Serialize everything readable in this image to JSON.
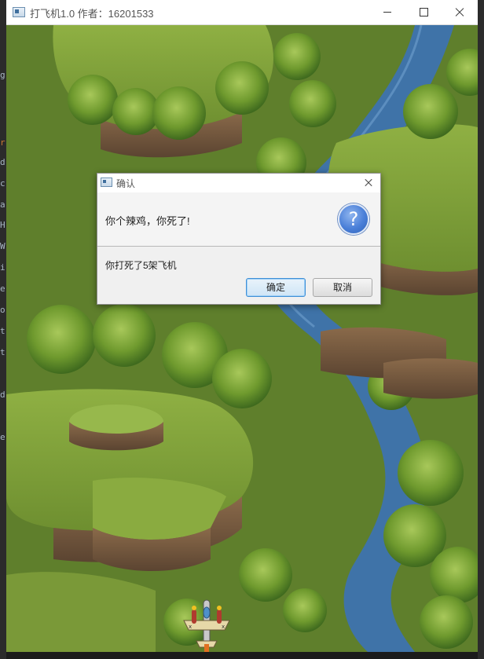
{
  "window": {
    "title": "打飞机1.0 作者：16201533",
    "controls": [
      "minimize",
      "maximize",
      "close"
    ]
  },
  "ide_edge_glyphs": [
    "g",
    "r",
    "d",
    "c",
    "a",
    "H",
    "W",
    "i",
    "e",
    "o",
    "t",
    "t",
    "d",
    "e"
  ],
  "dialog": {
    "title": "确认",
    "header": "你个辣鸡，你死了!",
    "icon": "question-icon",
    "message": "你打死了5架飞机",
    "buttons": {
      "ok": "确定",
      "cancel": "取消"
    }
  },
  "colors": {
    "accent_button_border": "#3f8fd6",
    "question_icon": "#4a7fd8",
    "river": "#3f73a8",
    "grass": "#7e9d3c"
  }
}
